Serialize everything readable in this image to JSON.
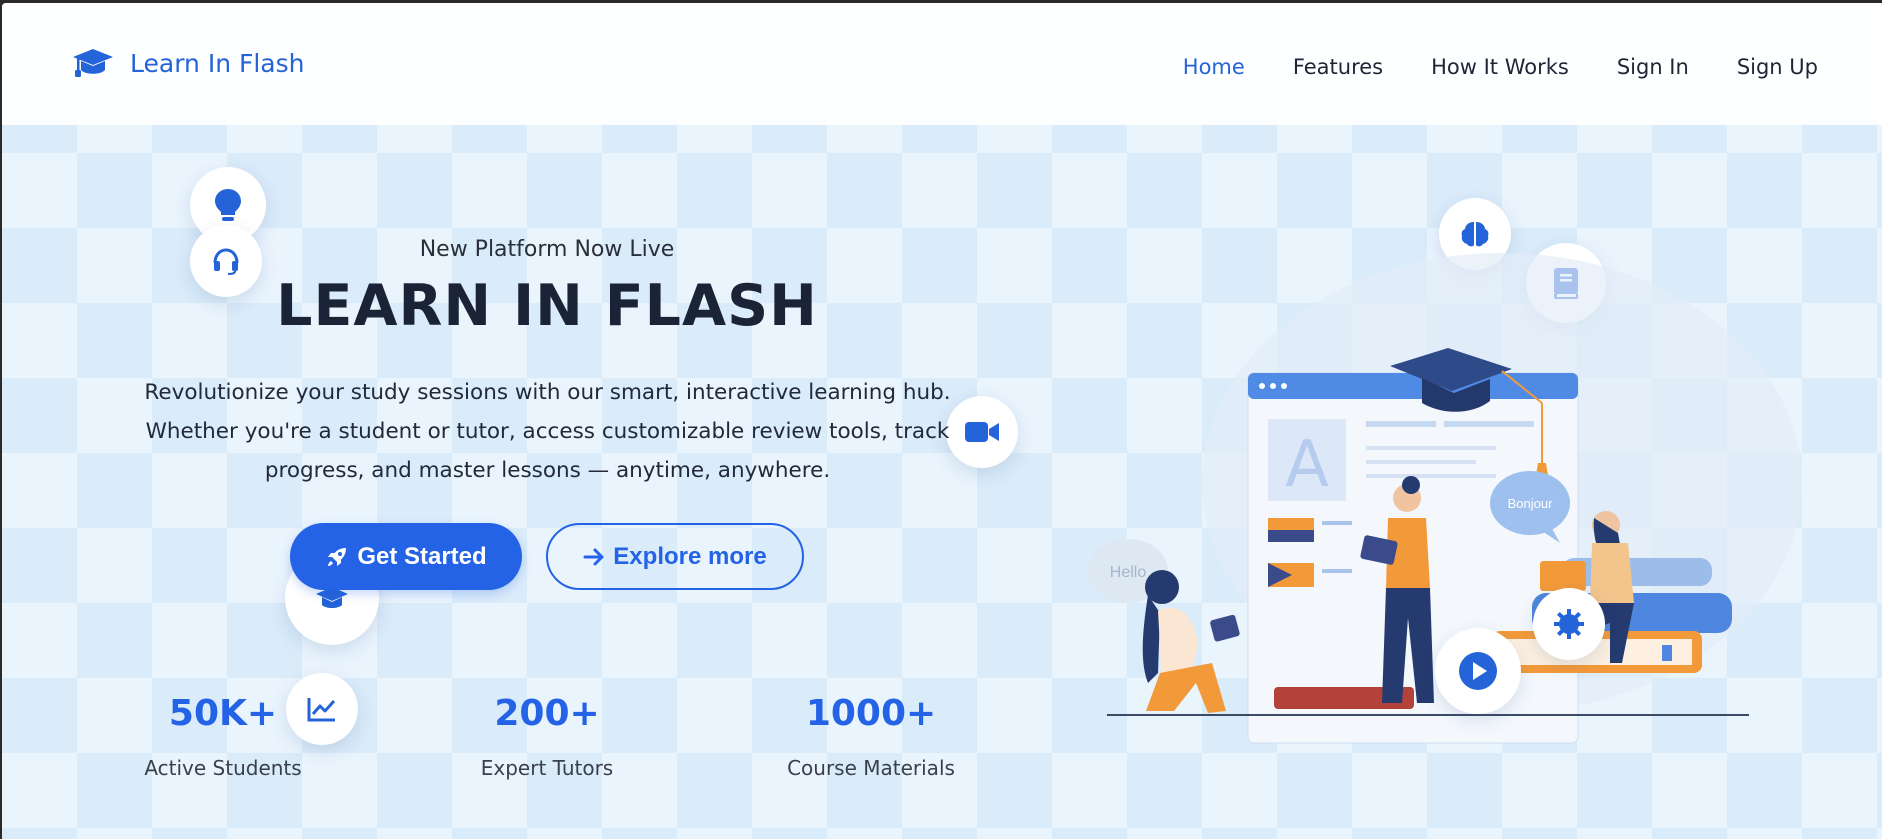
{
  "brand": {
    "name": "Learn In Flash"
  },
  "nav": {
    "items": [
      {
        "label": "Home",
        "active": true
      },
      {
        "label": "Features"
      },
      {
        "label": "How It Works"
      },
      {
        "label": "Sign In"
      },
      {
        "label": "Sign Up"
      }
    ]
  },
  "hero": {
    "eyebrow": "New Platform Now Live",
    "title": "LEARN IN FLASH",
    "description": "Revolutionize your study sessions with our smart, interactive learning hub. Whether you're a student or tutor, access customizable review tools, track progress, and master lessons — anytime, anywhere.",
    "primary_button": "Get Started",
    "secondary_button": "Explore more"
  },
  "stats": [
    {
      "value": "50K+",
      "label": "Active Students"
    },
    {
      "value": "200+",
      "label": "Expert Tutors"
    },
    {
      "value": "1000+",
      "label": "Course Materials"
    }
  ],
  "illustration": {
    "speech_left": "Hello",
    "speech_right": "Bonjour",
    "letter": "A"
  },
  "icons": [
    "graduation-cap-icon",
    "lightbulb-icon",
    "headset-icon",
    "video-camera-icon",
    "chart-line-icon",
    "brain-icon",
    "book-icon",
    "gear-icon",
    "play-icon",
    "rocket-icon",
    "arrow-right-icon"
  ],
  "colors": {
    "accent": "#2563e6",
    "title": "#1b2436",
    "background": "#eaf4fd"
  }
}
